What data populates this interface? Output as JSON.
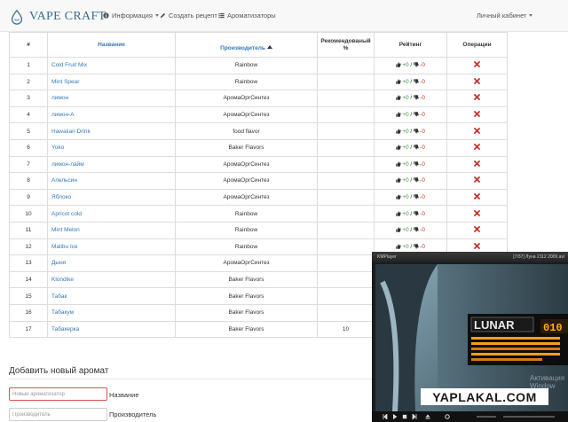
{
  "navbar": {
    "brand": "VAPE CRAFT",
    "items": [
      {
        "label": "Информация",
        "icon": "info-circle-icon",
        "dropdown": true
      },
      {
        "label": "Создать рецепт",
        "icon": "pencil-icon",
        "dropdown": false
      },
      {
        "label": "Ароматизаторы",
        "icon": "list-icon",
        "dropdown": false
      }
    ],
    "account": {
      "label": "Личный кабинет",
      "dropdown": true
    }
  },
  "table": {
    "headers": {
      "num": "#",
      "name": "Название",
      "manufacturer": "Производитель",
      "recommended": "Рекомендованый %",
      "rating": "Рейтинг",
      "operations": "Операции"
    },
    "rows": [
      {
        "num": "1",
        "name": "Cold Fruit Mix",
        "manufacturer": "Rainbow",
        "recommended": "",
        "up": "+0",
        "down": "-0"
      },
      {
        "num": "2",
        "name": "Mint Spear",
        "manufacturer": "Rainbow",
        "recommended": "",
        "up": "+0",
        "down": "-0"
      },
      {
        "num": "3",
        "name": "лимон",
        "manufacturer": "АромаОргСинтез",
        "recommended": "",
        "up": "+0",
        "down": "-0"
      },
      {
        "num": "4",
        "name": "лимон-А",
        "manufacturer": "АромаОргСинтез",
        "recommended": "",
        "up": "+0",
        "down": "-0"
      },
      {
        "num": "5",
        "name": "Hawaiian Drink",
        "manufacturer": "food flavor",
        "recommended": "",
        "up": "+0",
        "down": "-0"
      },
      {
        "num": "6",
        "name": "Yoko",
        "manufacturer": "Baker Flavors",
        "recommended": "",
        "up": "+0",
        "down": "-0"
      },
      {
        "num": "7",
        "name": "лимон-лайм",
        "manufacturer": "АромаОргСинтез",
        "recommended": "",
        "up": "+0",
        "down": "-0"
      },
      {
        "num": "8",
        "name": "Апельсин",
        "manufacturer": "АромаОргСинтез",
        "recommended": "",
        "up": "+0",
        "down": "-0"
      },
      {
        "num": "9",
        "name": "Яблоко",
        "manufacturer": "АромаОргСинтез",
        "recommended": "",
        "up": "+0",
        "down": "-0"
      },
      {
        "num": "10",
        "name": "Apricot cold",
        "manufacturer": "Rainbow",
        "recommended": "",
        "up": "+0",
        "down": "-0"
      },
      {
        "num": "11",
        "name": "Mint Melon",
        "manufacturer": "Rainbow",
        "recommended": "",
        "up": "+0",
        "down": "-0"
      },
      {
        "num": "12",
        "name": "Malibu Ice",
        "manufacturer": "Rainbow",
        "recommended": "",
        "up": "+0",
        "down": "-0"
      },
      {
        "num": "13",
        "name": "Дыня",
        "manufacturer": "АромаОргСинтез",
        "recommended": "",
        "up": "",
        "down": ""
      },
      {
        "num": "14",
        "name": "Klondike",
        "manufacturer": "Baker Flavors",
        "recommended": "",
        "up": "",
        "down": ""
      },
      {
        "num": "15",
        "name": "Табак",
        "manufacturer": "Baker Flavors",
        "recommended": "",
        "up": "",
        "down": ""
      },
      {
        "num": "16",
        "name": "Табакум",
        "manufacturer": "Baker Flavors",
        "recommended": "",
        "up": "",
        "down": ""
      },
      {
        "num": "17",
        "name": "Табакерка",
        "manufacturer": "Baker Flavors",
        "recommended": "10",
        "up": "",
        "down": ""
      }
    ]
  },
  "form": {
    "title": "Добавить новый аромат",
    "name_placeholder": "Новый ароматизатор",
    "name_label": "Название",
    "manufacturer_placeholder": "Производитель",
    "manufacturer_label": "Производитель"
  },
  "player": {
    "app_title": "KMPlayer",
    "file_title": "[7/37] Луна 2112 2009.avi",
    "screen_text": "LUNAR",
    "timer_text": "010"
  },
  "overlay": {
    "watermark": "YAPLAKAL.COM",
    "windows_activation": "Активация Window"
  },
  "colors": {
    "link": "#337ab7",
    "delete": "#c9302c",
    "up": "#3c9a3c",
    "down": "#c9302c"
  }
}
